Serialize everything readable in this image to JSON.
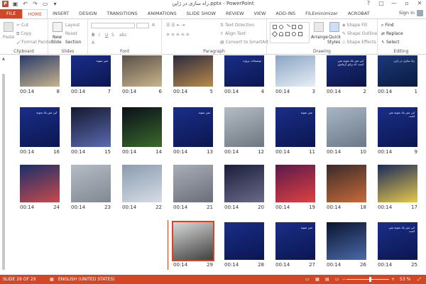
{
  "app": {
    "title": "راه سازی در ژاپن.pptx - PowerPoint",
    "sign_in": "Sign in",
    "window_controls": [
      "?",
      "□",
      "—",
      "▫",
      "✕"
    ]
  },
  "ribbon": {
    "tabs": [
      "FILE",
      "HOME",
      "INSERT",
      "DESIGN",
      "TRANSITIONS",
      "ANIMATIONS",
      "SLIDE SHOW",
      "REVIEW",
      "VIEW",
      "ADD-INS",
      "FILEminimizer",
      "ACROBAT"
    ],
    "active_tab": "HOME",
    "clipboard": {
      "label": "Clipboard",
      "paste": "Paste",
      "cut": "Cut",
      "copy": "Copy",
      "format_painter": "Format Painter"
    },
    "slides": {
      "label": "Slides",
      "new_slide": "New",
      "new_slide_2": "Slide",
      "layout": "Layout",
      "reset": "Reset",
      "section": "Section"
    },
    "font": {
      "label": "Font"
    },
    "paragraph": {
      "label": "Paragraph",
      "text_direction": "Text Direction",
      "align_text": "Align Text",
      "convert_smartart": "Convert to SmartArt"
    },
    "drawing": {
      "label": "Drawing",
      "arrange": "Arrange",
      "quick_styles": "Quick",
      "quick_styles_2": "Styles",
      "shape_fill": "Shape Fill",
      "shape_outline": "Shape Outline",
      "shape_effects": "Shape Effects"
    },
    "editing": {
      "label": "Editing",
      "find": "Find",
      "replace": "Replace",
      "select": "Select"
    }
  },
  "slides": [
    {
      "num": "1",
      "time": "00:14",
      "text": "راه سازی در ژاپن",
      "colors": [
        "#1a3a7a",
        "#0b1a40"
      ]
    },
    {
      "num": "2",
      "time": "00:14",
      "text": "اين متن يك نمونه متن است كه براي آزمايش",
      "colors": [
        "#1b2f80",
        "#0a1445"
      ]
    },
    {
      "num": "3",
      "time": "00:14",
      "text": "",
      "colors": [
        "#8aa4c4",
        "#e8eef5"
      ]
    },
    {
      "num": "4",
      "time": "00:14",
      "text": "توضيحات پروژه",
      "colors": [
        "#1a2e88",
        "#0b1650"
      ]
    },
    {
      "num": "5",
      "time": "00:14",
      "text": "",
      "colors": [
        "#2b2a3e",
        "#b98a4a"
      ]
    },
    {
      "num": "6",
      "time": "00:14",
      "text": "",
      "colors": [
        "#5a5048",
        "#c9b48a"
      ]
    },
    {
      "num": "7",
      "time": "00:14",
      "text": "متن نمونه",
      "colors": [
        "#1a2e88",
        "#0b1650"
      ]
    },
    {
      "num": "8",
      "time": "00:14",
      "text": "",
      "colors": [
        "#2a3a6a",
        "#c6b48a"
      ]
    },
    {
      "num": "9",
      "time": "00:14",
      "text": "اين متن يك نمونه متن است",
      "colors": [
        "#1a2e88",
        "#0b1650"
      ]
    },
    {
      "num": "10",
      "time": "00:14",
      "text": "",
      "colors": [
        "#a8b6c6",
        "#6a7888"
      ]
    },
    {
      "num": "11",
      "time": "00:14",
      "text": "متن نمونه",
      "colors": [
        "#1a2e88",
        "#0b1650"
      ]
    },
    {
      "num": "12",
      "time": "00:14",
      "text": "",
      "colors": [
        "#b4bcc4",
        "#6e7680"
      ]
    },
    {
      "num": "13",
      "time": "00:14",
      "text": "متن نمونه",
      "colors": [
        "#1a2e88",
        "#0b1650"
      ]
    },
    {
      "num": "14",
      "time": "00:14",
      "text": "",
      "colors": [
        "#0a0e1a",
        "#3a6a2a"
      ]
    },
    {
      "num": "15",
      "time": "00:14",
      "text": "",
      "colors": [
        "#141830",
        "#5a6ab0"
      ]
    },
    {
      "num": "16",
      "time": "00:14",
      "text": "اين متن يك نمونه",
      "colors": [
        "#1a2e88",
        "#0b1650"
      ]
    },
    {
      "num": "17",
      "time": "00:14",
      "text": "",
      "colors": [
        "#1a2a5a",
        "#e6c84a"
      ]
    },
    {
      "num": "18",
      "time": "00:14",
      "text": "",
      "colors": [
        "#3a2a2a",
        "#c86a3a"
      ]
    },
    {
      "num": "19",
      "time": "00:14",
      "text": "",
      "colors": [
        "#5a1a4a",
        "#e04040"
      ]
    },
    {
      "num": "20",
      "time": "00:14",
      "text": "",
      "colors": [
        "#1a1e3a",
        "#6a6a88"
      ]
    },
    {
      "num": "21",
      "time": "00:14",
      "text": "",
      "colors": [
        "#a8aeb6",
        "#6a6e7a"
      ]
    },
    {
      "num": "22",
      "time": "00:14",
      "text": "",
      "colors": [
        "#8a9cb0",
        "#d6dce4"
      ]
    },
    {
      "num": "23",
      "time": "00:14",
      "text": "",
      "colors": [
        "#b6bcc4",
        "#808892"
      ]
    },
    {
      "num": "24",
      "time": "00:14",
      "text": "",
      "colors": [
        "#1a2e6a",
        "#c84a4a"
      ]
    },
    {
      "num": "25",
      "time": "00:14",
      "text": "اين متن يك نمونه متن است",
      "colors": [
        "#1a2e88",
        "#0b1650"
      ]
    },
    {
      "num": "26",
      "time": "00:14",
      "text": "",
      "colors": [
        "#0a1430",
        "#4a6aa8"
      ]
    },
    {
      "num": "27",
      "time": "00:14",
      "text": "متن نمونه",
      "colors": [
        "#1a2e88",
        "#0b1650"
      ]
    },
    {
      "num": "28",
      "time": "00:14",
      "text": "",
      "colors": [
        "#1a2e88",
        "#0b1650"
      ]
    },
    {
      "num": "29",
      "time": "00:14",
      "text": "",
      "colors": [
        "#d8d8d8",
        "#404040"
      ]
    }
  ],
  "selected_slide": "29",
  "status": {
    "slide_info": "SLIDE 29 OF 29",
    "language": "ENGLISH (UNITED STATES)",
    "zoom": "53 %"
  },
  "theme": {
    "accent": "#d24726"
  }
}
